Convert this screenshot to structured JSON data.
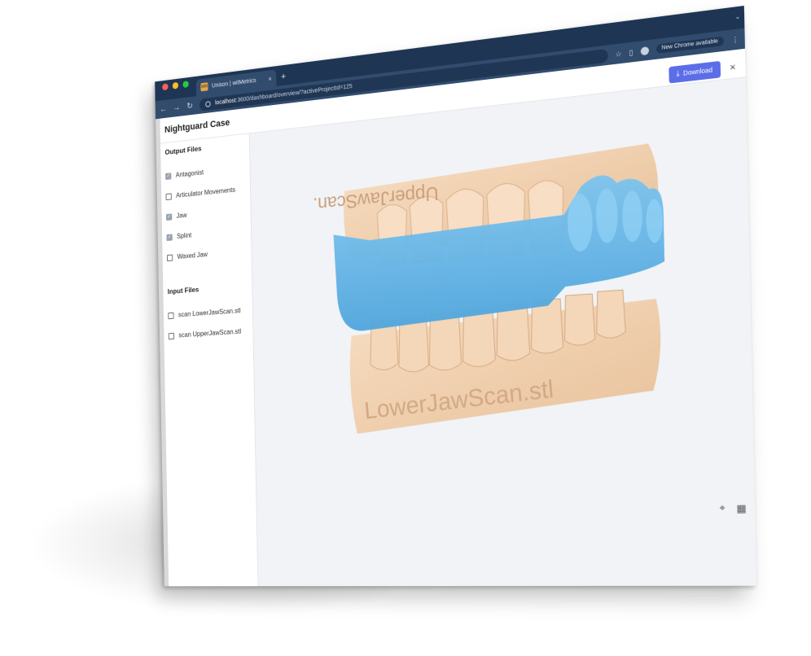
{
  "browser": {
    "tab_title": "Unison | witMetrics",
    "favicon_text": "WM",
    "new_tab": "+",
    "url_host": "localhost",
    "url_rest": ":3600/dashboard/overview/?activeProjectId=125",
    "update_pill": "New Chrome available"
  },
  "app": {
    "title": "Nightguard Case",
    "download_label": "Download",
    "close_label": "×"
  },
  "output_files": {
    "heading": "Output Files",
    "items": [
      {
        "label": "Antagonist",
        "checked": true
      },
      {
        "label": "Articulator Movements",
        "checked": false
      },
      {
        "label": "Jaw",
        "checked": true
      },
      {
        "label": "Splint",
        "checked": true
      },
      {
        "label": "Waxed Jaw",
        "checked": false
      }
    ]
  },
  "input_files": {
    "heading": "Input Files",
    "items": [
      {
        "label": "scan LowerJawScan.stl",
        "checked": false
      },
      {
        "label": "scan UpperJawScan.stl",
        "checked": false
      }
    ]
  },
  "model": {
    "lower_engraving": "LowerJawScan.stl",
    "upper_engraving": "UpperJawScan.stl",
    "colors": {
      "stone": "#f3d3b2",
      "splint": "#63b5e8"
    }
  },
  "icons": {
    "viewer_tool_1": "focus-camera-icon",
    "viewer_tool_2": "grid-icon"
  }
}
